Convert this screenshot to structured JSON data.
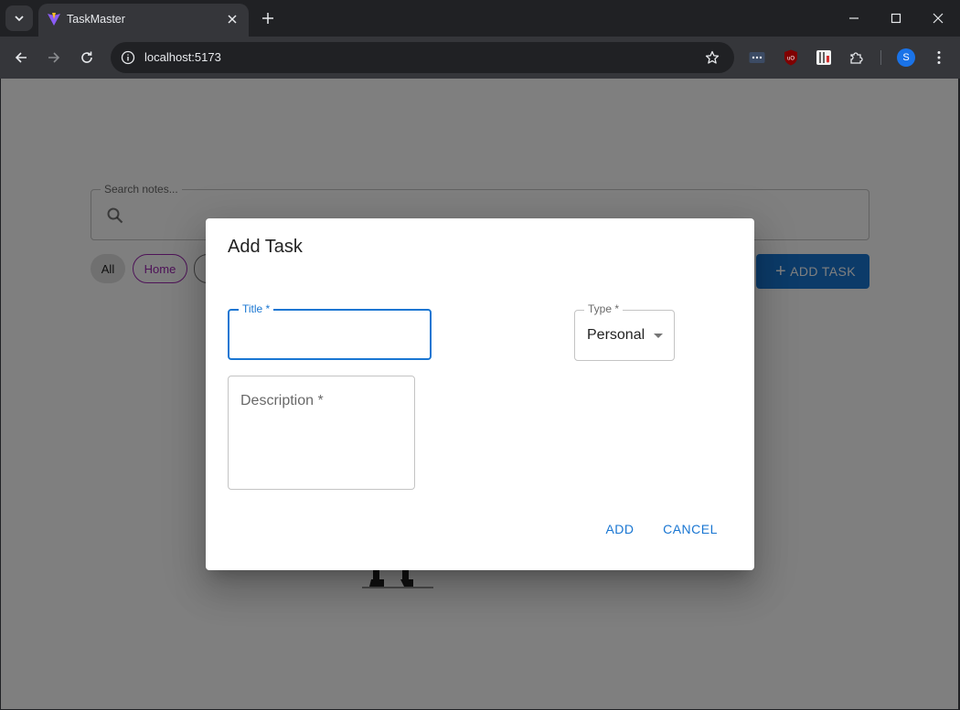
{
  "browser": {
    "tab_title": "TaskMaster",
    "url": "localhost:5173",
    "profile_initial": "S"
  },
  "page": {
    "search_label": "Search notes...",
    "filters": [
      "All",
      "Home",
      ""
    ],
    "add_task_label": "ADD TASK",
    "add_task_icon": "+"
  },
  "dialog": {
    "title": "Add Task",
    "title_field_label": "Title *",
    "title_value": "",
    "type_label": "Type *",
    "type_value": "Personal",
    "description_label": "Description *",
    "add_button": "ADD",
    "cancel_button": "CANCEL"
  },
  "colors": {
    "primary": "#1976d2",
    "home_chip": "#9c27b0"
  }
}
